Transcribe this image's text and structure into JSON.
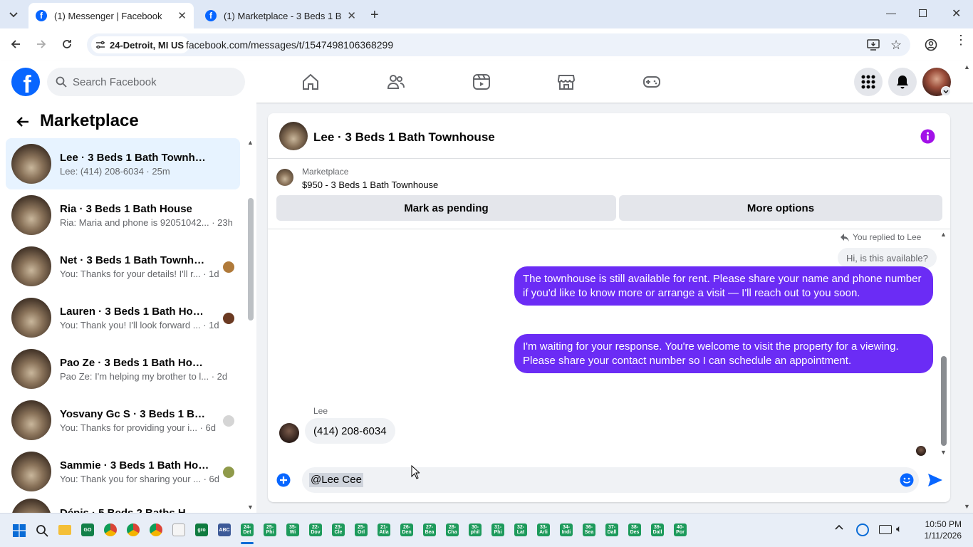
{
  "browser": {
    "tabs": [
      {
        "title": "(1) Messenger | Facebook",
        "active": true
      },
      {
        "title": "(1) Marketplace - 3 Beds 1 Bath",
        "active": false
      }
    ],
    "location": "24-Detroit, MI US",
    "url": "facebook.com/messages/t/1547498106368299"
  },
  "facebook": {
    "search_placeholder": "Search Facebook",
    "brand_color": "#0866ff",
    "nav_icons": [
      "home-icon",
      "friends-icon",
      "video-icon",
      "marketplace-icon",
      "gaming-icon"
    ]
  },
  "sidebar": {
    "title": "Marketplace",
    "conversations": [
      {
        "name": "Lee · 3 Beds 1 Bath Townhouse",
        "preview": "Lee: (414) 208-6034 · 25m",
        "selected": true
      },
      {
        "name": "Ria · 3 Beds 1 Bath House",
        "preview": "Ria: Maria and phone is 92051042... · 23h"
      },
      {
        "name": "Net · 3 Beds 1 Bath Townhouse",
        "preview": "You: Thanks for your details! I'll r... · 1d"
      },
      {
        "name": "Lauren · 3 Beds 1 Bath House",
        "preview": "You: Thank you! I'll look forward ... · 1d"
      },
      {
        "name": "Pao Ze · 3 Beds 1 Bath House",
        "preview": "Pao Ze: I'm helping my brother to l... · 2d"
      },
      {
        "name": "Yosvany Gc S · 3 Beds 1 Bath ...",
        "preview": "You: Thanks for providing your i... · 6d"
      },
      {
        "name": "Sammie · 3 Beds 1 Bath House",
        "preview": "You: Thank you for sharing your ... · 6d"
      },
      {
        "name": "Dénis · 5 Beds 2 Baths H...",
        "preview": ""
      }
    ]
  },
  "chat": {
    "title": "Lee · 3 Beds 1 Bath Townhouse",
    "listing_label": "Marketplace",
    "listing_title": "$950 - 3 Beds 1 Bath Townhouse",
    "mark_pending": "Mark as pending",
    "more_options": "More options",
    "replied_label": "You replied to Lee",
    "quoted_message": "Hi, is this available?",
    "messages_out": [
      "The townhouse is still available for rent. Please share your name and phone number if you'd like to know more or arrange a visit — I'll reach out to you soon.",
      "I'm waiting for your response. You're welcome to visit the property for a viewing. Please share your contact number so I can schedule an appointment."
    ],
    "incoming_sender": "Lee",
    "incoming_message": "(414) 208-6034",
    "composer_text": "@Lee Cee",
    "accent_color": "#6b2cf5"
  },
  "taskbar": {
    "time": "10:50 PM",
    "date": "1/11/2026",
    "apps": [
      "24-Det",
      "25-Phi",
      "35-Wi",
      "22-Dov",
      "23-Cle",
      "25-Orl",
      "21-Atla",
      "26-Den",
      "27-Bea",
      "28-Cha",
      "30-phil",
      "31-Phi",
      "32-Lat",
      "33-Arli",
      "34-Indi",
      "36-Sea",
      "37-Dall",
      "38-Des",
      "39-Dall",
      "40-Por"
    ]
  }
}
